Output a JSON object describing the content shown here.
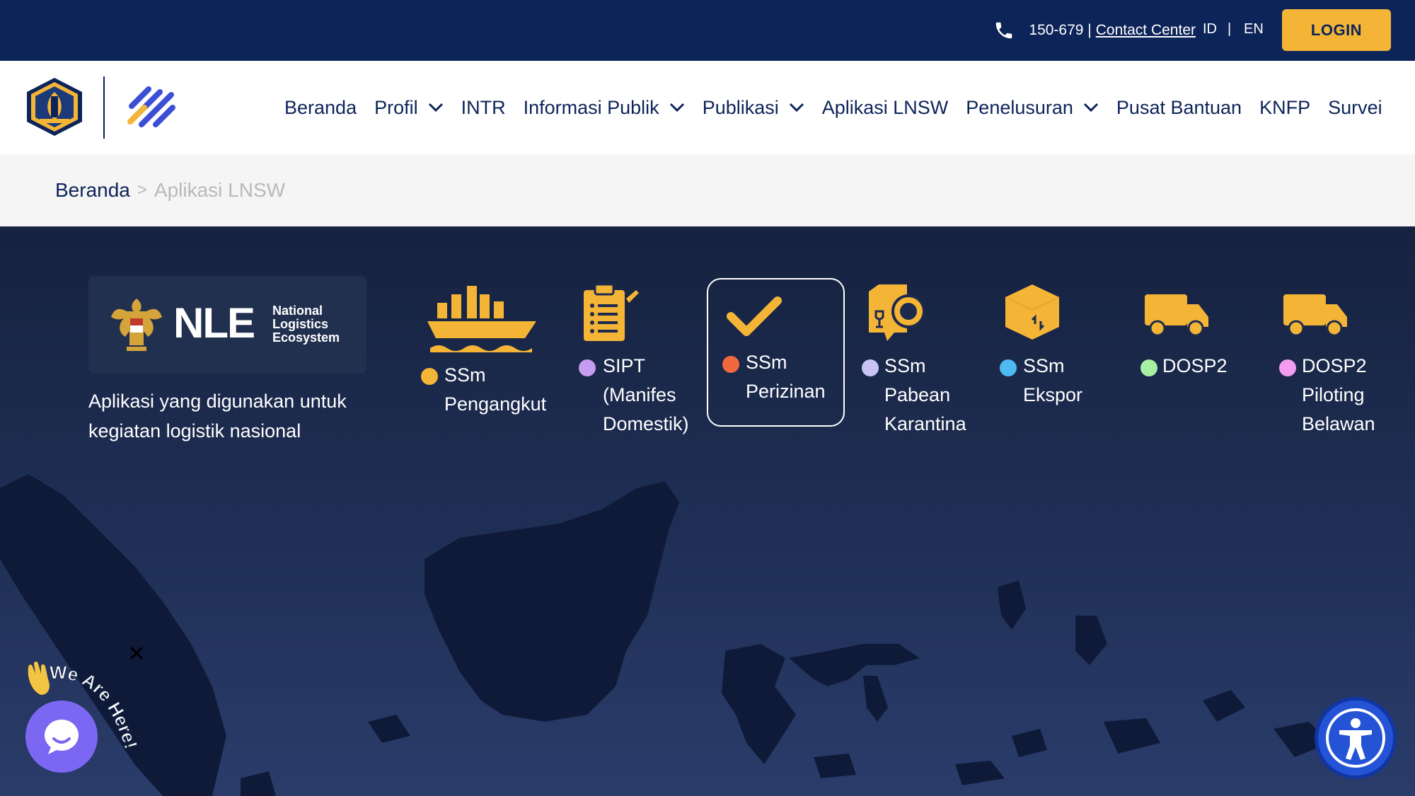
{
  "topbar": {
    "phone_number": "150-679 |",
    "contact_center": "Contact Center",
    "lang_id": "ID",
    "lang_sep": "|",
    "lang_en": "EN",
    "login_label": "LOGIN"
  },
  "nav": {
    "items": [
      {
        "label": "Beranda",
        "dropdown": false
      },
      {
        "label": "Profil",
        "dropdown": true
      },
      {
        "label": "INTR",
        "dropdown": false
      },
      {
        "label": "Informasi Publik",
        "dropdown": true
      },
      {
        "label": "Publikasi",
        "dropdown": true
      },
      {
        "label": "Aplikasi LNSW",
        "dropdown": false
      },
      {
        "label": "Penelusuran",
        "dropdown": true
      },
      {
        "label": "Pusat Bantuan",
        "dropdown": false
      },
      {
        "label": "KNFP",
        "dropdown": false
      },
      {
        "label": "Survei",
        "dropdown": false
      }
    ]
  },
  "breadcrumb": {
    "home": "Beranda",
    "separator": ">",
    "current": "Aplikasi LNSW"
  },
  "hero": {
    "nle_logo_text": [
      "National",
      "Logistics",
      "Ecosystem"
    ],
    "nle_letters": "NLE",
    "description": "Aplikasi yang digunakan untuk kegiatan logistik nasional",
    "apps": [
      {
        "lines": [
          "SSm",
          "Pengangkut"
        ],
        "dot_color": "#f4b537",
        "icon": "ship-icon"
      },
      {
        "lines": [
          "SIPT",
          "(Manifes",
          "Domestik)"
        ],
        "dot_color": "#c59cf0",
        "icon": "clipboard-icon"
      },
      {
        "lines": [
          "SSm",
          "Perizinan"
        ],
        "dot_color": "#f0683c",
        "icon": "checkmark-icon",
        "selected": true
      },
      {
        "lines": [
          "SSm",
          "Pabean",
          "Karantina"
        ],
        "dot_color": "#c9c3f4",
        "icon": "package-search-icon"
      },
      {
        "lines": [
          "SSm",
          "Ekspor"
        ],
        "dot_color": "#4fb9f2",
        "icon": "box-icon"
      },
      {
        "lines": [
          "DOSP2"
        ],
        "dot_color": "#a6f0a2",
        "icon": "truck-icon"
      },
      {
        "lines": [
          "DOSP2",
          "Piloting",
          "Belawan"
        ],
        "dot_color": "#f49cf0",
        "icon": "truck-icon"
      }
    ]
  },
  "widgets": {
    "chat_badge": "We Are Here!"
  },
  "colors": {
    "navy": "#0d2459",
    "accent": "#f4b537",
    "hero_bg": "#1c2a4d"
  }
}
